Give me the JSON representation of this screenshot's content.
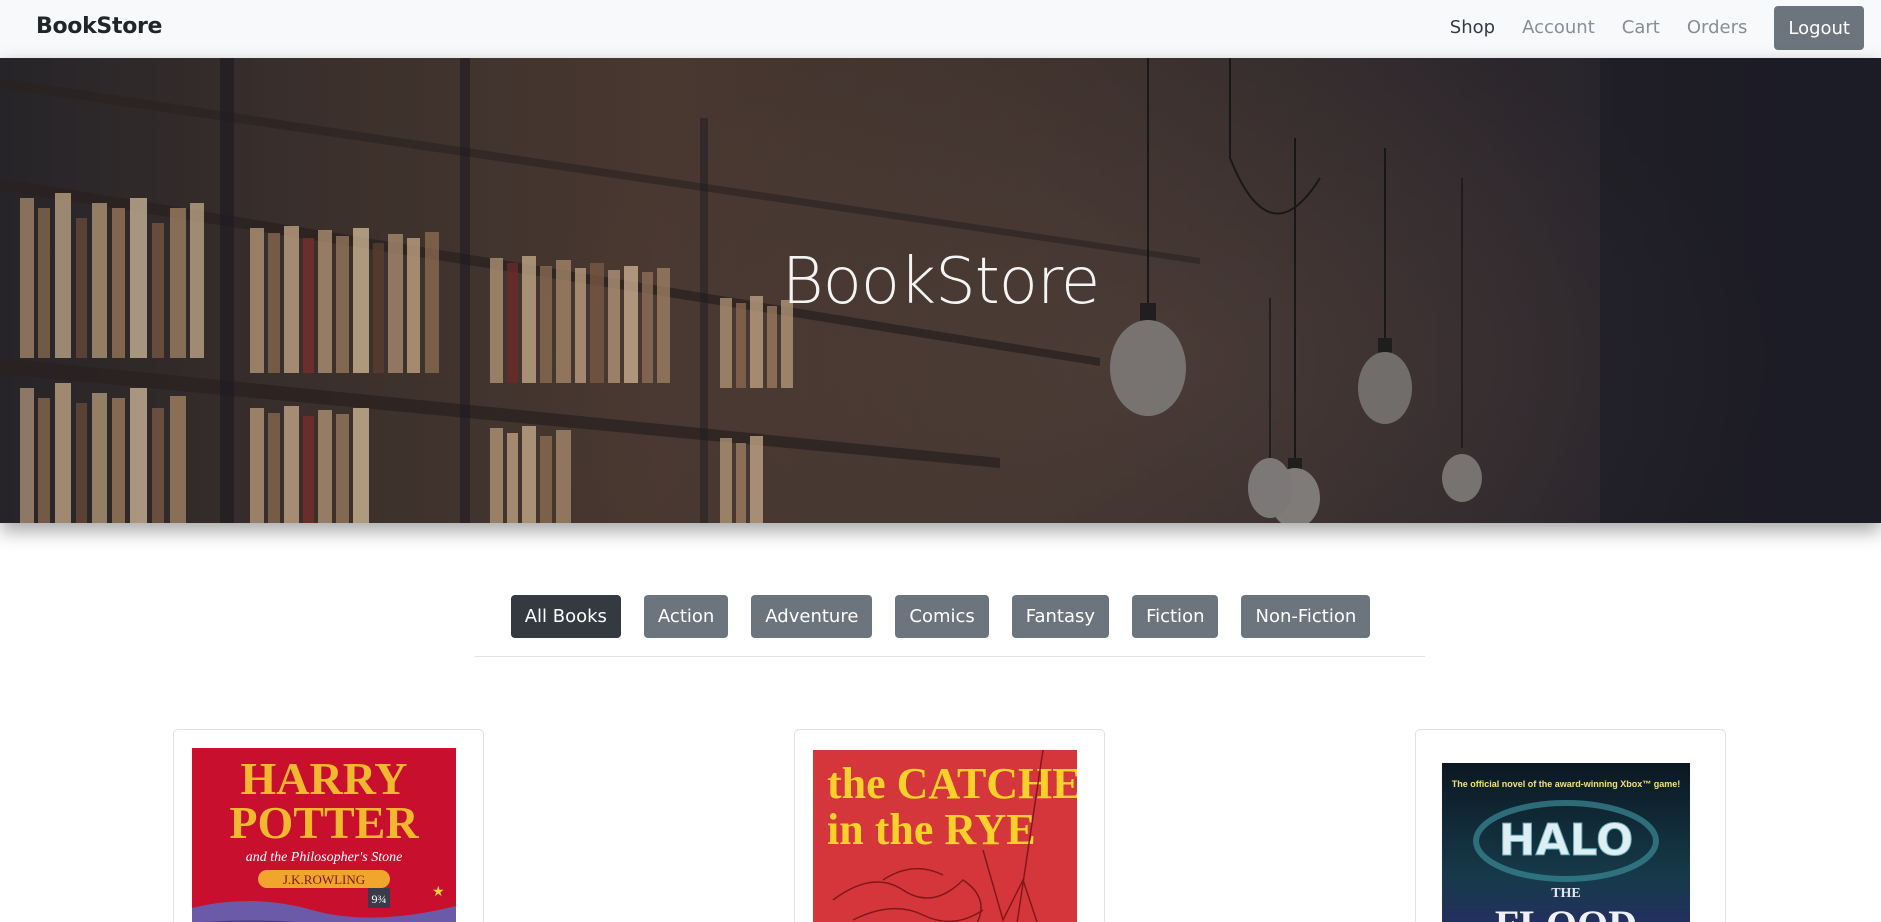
{
  "navbar": {
    "brand": "BookStore",
    "links": [
      "Shop",
      "Account",
      "Cart",
      "Orders"
    ],
    "active_link": "Shop",
    "logout_label": "Logout"
  },
  "hero": {
    "title": "BookStore"
  },
  "filters": {
    "buttons": [
      "All Books",
      "Action",
      "Adventure",
      "Comics",
      "Fantasy",
      "Fiction",
      "Non-Fiction"
    ],
    "active": "All Books"
  },
  "books": [
    {
      "cover_title_line1": "HARRY",
      "cover_title_line2": "POTTER",
      "cover_subtitle": "and the Philosopher's Stone",
      "cover_author": "J.K.ROWLING",
      "cover_badge": "9¾",
      "cover_color": "#c8102e"
    },
    {
      "cover_title_line1": "the CATCHER",
      "cover_title_line2": "in the RYE",
      "cover_color": "#d5363c"
    },
    {
      "cover_tagline": "The official novel of the award-winning Xbox™ game!",
      "cover_title": "HALO",
      "cover_subtitle": "THE",
      "cover_subtitle2": "FLOOD",
      "cover_color": "#0e1f2c"
    }
  ]
}
